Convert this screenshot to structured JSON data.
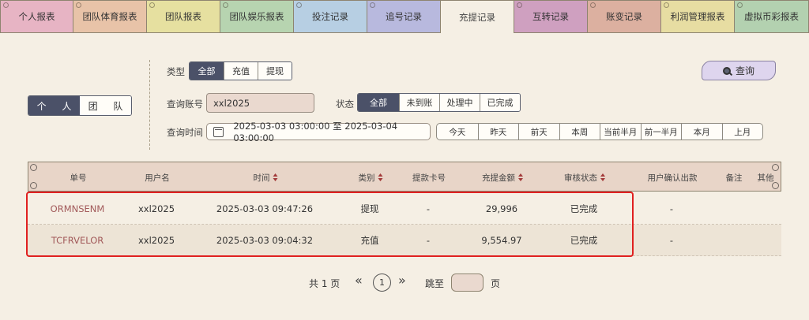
{
  "tabs": [
    {
      "label": "个人报表",
      "color": "#e7b4c4"
    },
    {
      "label": "团队体育报表",
      "color": "#e8c3a8"
    },
    {
      "label": "团队报表",
      "color": "#e6e0a0"
    },
    {
      "label": "团队娱乐报表",
      "color": "#b7d4b0"
    },
    {
      "label": "投注记录",
      "color": "#b7cfe3"
    },
    {
      "label": "追号记录",
      "color": "#b8b9de"
    },
    {
      "label": "充提记录",
      "color": "#f5efe4"
    },
    {
      "label": "互转记录",
      "color": "#cfa0c0"
    },
    {
      "label": "账变记录",
      "color": "#dcb0a0"
    },
    {
      "label": "利润管理报表",
      "color": "#e7dda2"
    },
    {
      "label": "虚拟币彩报表",
      "color": "#b3d1b0"
    }
  ],
  "active_tab": "充提记录",
  "scope": {
    "personal": "个 人",
    "team": "团 队"
  },
  "filters": {
    "type_label": "类型",
    "type_options": [
      "全部",
      "充值",
      "提现"
    ],
    "account_label": "查询账号",
    "account_value": "xxl2025",
    "status_label": "状态",
    "status_options": [
      "全部",
      "未到账",
      "处理中",
      "已完成"
    ],
    "time_label": "查询时间",
    "time_range": "2025-03-03 03:00:00 至 2025-03-04 03:00:00",
    "quick_ranges": [
      "今天",
      "昨天",
      "前天",
      "本周",
      "当前半月",
      "前一半月",
      "本月",
      "上月"
    ]
  },
  "query_button": "查询",
  "table": {
    "headers": [
      "单号",
      "用户名",
      "时间",
      "类别",
      "提款卡号",
      "充提金额",
      "审核状态",
      "用户确认出款",
      "备注",
      "其他"
    ],
    "rows": [
      [
        "ORMNSENM",
        "xxl2025",
        "2025-03-03 09:47:26",
        "提现",
        "-",
        "29,996",
        "已完成",
        "-",
        "",
        ""
      ],
      [
        "TCFRVELOR",
        "xxl2025",
        "2025-03-03 09:04:32",
        "充值",
        "-",
        "9,554.97",
        "已完成",
        "-",
        "",
        ""
      ]
    ]
  },
  "pager": {
    "total": "共 1 页",
    "prev": "«",
    "current": "1",
    "next": "»",
    "jump_label": "跳至",
    "page_unit": "页"
  }
}
